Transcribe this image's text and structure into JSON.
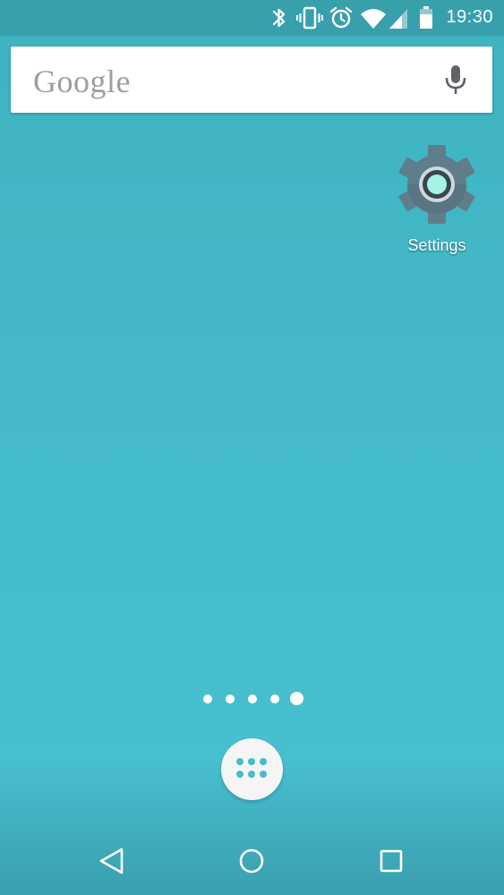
{
  "status_bar": {
    "time": "19:30",
    "icons": [
      "bluetooth-icon",
      "vibrate-icon",
      "alarm-icon",
      "wifi-icon",
      "cell-signal-icon",
      "battery-icon"
    ]
  },
  "search": {
    "logo_text": "Google",
    "icon": "microphone-icon"
  },
  "home_icons": [
    {
      "label": "Settings",
      "icon": "settings-gear-icon"
    }
  ],
  "page_indicator": {
    "count": 5,
    "active_index": 4
  },
  "dock": {
    "icon": "app-drawer-icon"
  },
  "nav_bar": {
    "buttons": [
      "back-icon",
      "home-icon",
      "recents-icon"
    ]
  },
  "colors": {
    "wallpaper": "#45bccc",
    "search_logo": "#9e9e9e",
    "settings_gear": "#5f7d8b",
    "settings_accent": "#a7f2e7"
  }
}
